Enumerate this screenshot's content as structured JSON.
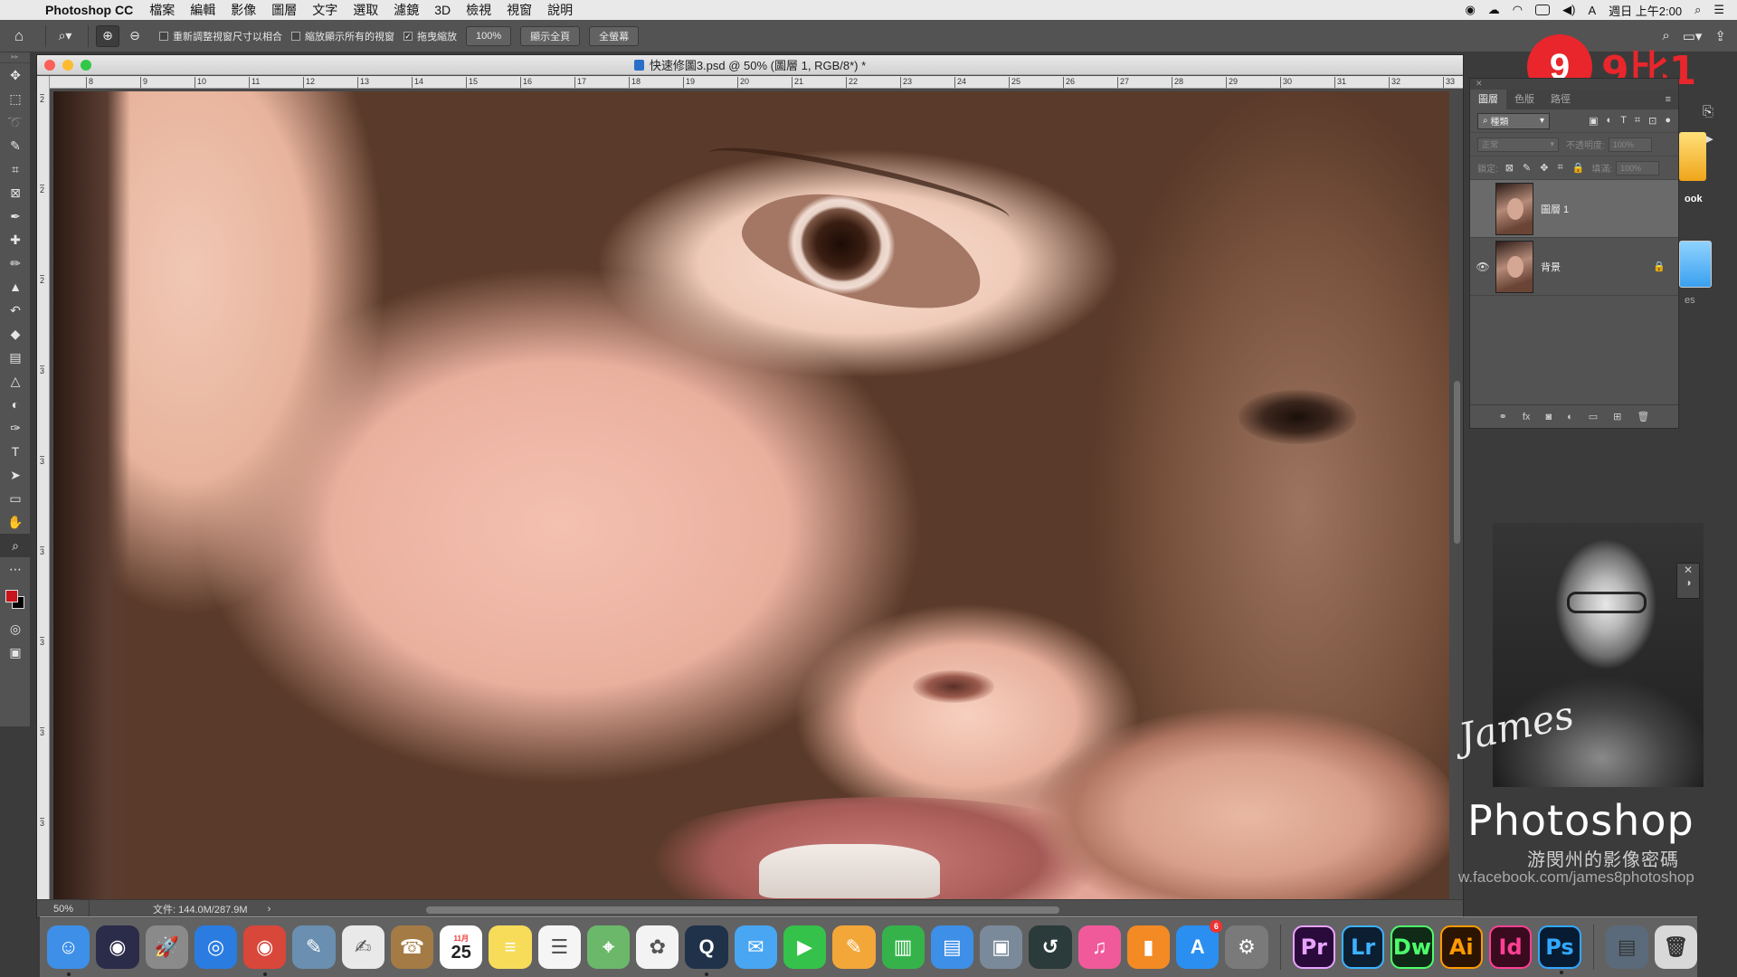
{
  "menubar": {
    "app_name": "Photoshop CC",
    "menus": [
      "檔案",
      "編輯",
      "影像",
      "圖層",
      "文字",
      "選取",
      "濾鏡",
      "3D",
      "檢視",
      "視窗",
      "說明"
    ],
    "clock": "週日 上午2:00"
  },
  "options": {
    "resize_windows": "重新調整視窗尺寸以相合",
    "zoom_all_windows": "縮放顯示所有的視窗",
    "scrubby_zoom": "拖曳縮放",
    "zoom_100": "100%",
    "fit_screen": "顯示全頁",
    "fill_screen": "全螢幕"
  },
  "document": {
    "title": "快速修圖3.psd @ 50% (圖層 1, RGB/8*) *",
    "zoom": "50%",
    "file_size": "文件: 144.0M/287.9M",
    "ruler_h": [
      "8",
      "9",
      "10",
      "11",
      "12",
      "13",
      "14",
      "15",
      "16",
      "17",
      "18",
      "19",
      "20",
      "21",
      "22",
      "23",
      "24",
      "25",
      "26",
      "27",
      "28",
      "29",
      "30",
      "31",
      "32",
      "33"
    ],
    "ruler_v": [
      "2",
      "2",
      "2",
      "3",
      "3",
      "3",
      "3",
      "3",
      "3"
    ]
  },
  "layers_panel": {
    "tabs": [
      "圖層",
      "色版",
      "路徑"
    ],
    "kind_filter": "種類",
    "blend_mode": "正常",
    "opacity_label": "不透明度:",
    "opacity_value": "100%",
    "lock_label": "鎖定:",
    "fill_label": "填滿:",
    "fill_value": "100%",
    "layers": [
      {
        "name": "圖層 1",
        "visible": false,
        "selected": true,
        "locked": false
      },
      {
        "name": "背景",
        "visible": true,
        "selected": false,
        "locked": true
      }
    ]
  },
  "side_strip": {
    "label": "ook",
    "label2": "es"
  },
  "logo": {
    "mark": "9",
    "text": "9比1"
  },
  "branding": {
    "signature": "James",
    "title": "Photoshop",
    "subtitle": "游閔州的影像密碼",
    "url": "w.facebook.com/james8photoshop"
  },
  "dock": {
    "calendar_day": "25",
    "calendar_month": "11月",
    "apps": [
      {
        "name": "finder",
        "label": "☺",
        "color": "#3d8fe8"
      },
      {
        "name": "siri",
        "label": "◉",
        "color": "#2b2b4a"
      },
      {
        "name": "launchpad",
        "label": "🚀",
        "color": "#8a8a8a"
      },
      {
        "name": "safari",
        "label": "◎",
        "color": "#2a7ce0"
      },
      {
        "name": "chrome",
        "label": "◉",
        "color": "#d9463a"
      },
      {
        "name": "preview",
        "label": "✎",
        "color": "#6a8fb0"
      },
      {
        "name": "textedit",
        "label": "✍",
        "color": "#e9e9e9"
      },
      {
        "name": "contacts",
        "label": "☎",
        "color": "#a47b45"
      },
      {
        "name": "calendar",
        "label": "25",
        "color": "#ffffff"
      },
      {
        "name": "notes",
        "label": "≡",
        "color": "#f7dc5a"
      },
      {
        "name": "reminders",
        "label": "☰",
        "color": "#f5f5f5"
      },
      {
        "name": "maps",
        "label": "⌖",
        "color": "#6bb86a"
      },
      {
        "name": "photos",
        "label": "✿",
        "color": "#f3f3f3"
      },
      {
        "name": "quicktime",
        "label": "Q",
        "color": "#20324a"
      },
      {
        "name": "messages",
        "label": "✉",
        "color": "#48a6f2"
      },
      {
        "name": "facetime",
        "label": "▶",
        "color": "#35c24a"
      },
      {
        "name": "pages",
        "label": "✎",
        "color": "#f3a738"
      },
      {
        "name": "numbers",
        "label": "▥",
        "color": "#35b34a"
      },
      {
        "name": "keynote",
        "label": "▤",
        "color": "#3d8fe8"
      },
      {
        "name": "image-capture",
        "label": "▣",
        "color": "#7a8a9a"
      },
      {
        "name": "time-machine",
        "label": "↺",
        "color": "#2b3a3a"
      },
      {
        "name": "itunes",
        "label": "♫",
        "color": "#f05a9a"
      },
      {
        "name": "ibooks",
        "label": "▮",
        "color": "#f38a24"
      },
      {
        "name": "app-store",
        "label": "A",
        "color": "#2a8ff0"
      },
      {
        "name": "system-preferences",
        "label": "⚙",
        "color": "#7a7a7a"
      },
      {
        "name": "premiere",
        "label": "Pr",
        "color": "#2a0a3a"
      },
      {
        "name": "lightroom",
        "label": "Lr",
        "color": "#0b1e32"
      },
      {
        "name": "dreamweaver",
        "label": "Dw",
        "color": "#0f2a16"
      },
      {
        "name": "illustrator",
        "label": "Ai",
        "color": "#2c1402"
      },
      {
        "name": "indesign",
        "label": "Id",
        "color": "#3a0a1e"
      },
      {
        "name": "photoshop",
        "label": "Ps",
        "color": "#071c33"
      }
    ]
  },
  "colors": {
    "foreground": "#c8141c",
    "background": "#000000",
    "adobe_pr": "#e9a3ff",
    "adobe_lr": "#3db2ff",
    "adobe_dw": "#4dff6b",
    "adobe_ai": "#ff9a00",
    "adobe_id": "#ff3f94",
    "adobe_ps": "#31a8ff"
  }
}
